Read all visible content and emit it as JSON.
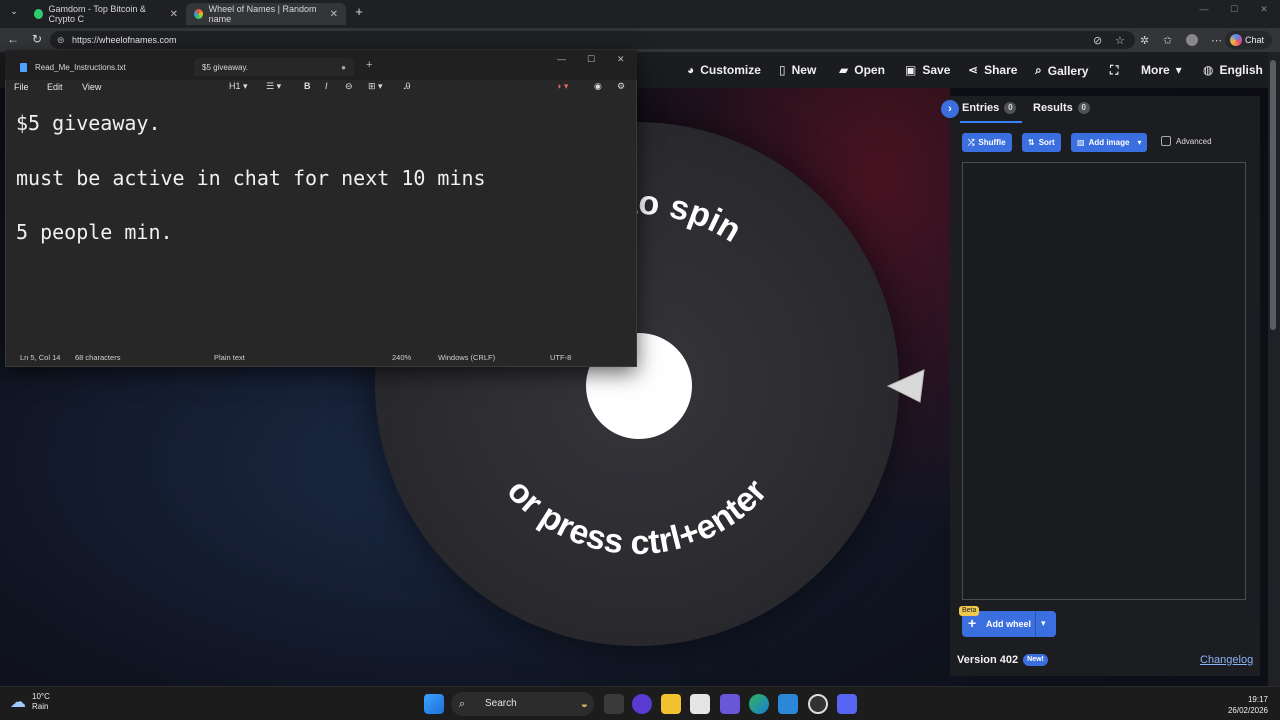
{
  "browser": {
    "tabs": [
      {
        "title": "Gamdom - Top Bitcoin & Crypto C",
        "favicon_color": "#2ecc71"
      },
      {
        "title": "Wheel of Names | Random name",
        "favicon_color": "#e74c3c"
      }
    ],
    "new_tab_symbol": "+",
    "url": "https://wheelofnames.com",
    "chat_label": "Chat"
  },
  "site_nav": {
    "customize": "Customize",
    "new": "New",
    "open": "Open",
    "save": "Save",
    "share": "Share",
    "gallery": "Gallery",
    "more": "More",
    "language": "English"
  },
  "wheel": {
    "text_top": "Click to spin",
    "visible_top_fragment": "to spin",
    "text_bottom": "or press ctrl+enter"
  },
  "sidebar": {
    "entries_label": "Entries",
    "entries_count": "0",
    "results_label": "Results",
    "results_count": "0",
    "shuffle": "Shuffle",
    "sort": "Sort",
    "add_image": "Add image",
    "advanced": "Advanced",
    "beta": "Beta",
    "add_wheel": "Add wheel",
    "version": "Version 402",
    "new_badge": "New!",
    "changelog": "Changelog"
  },
  "notepad": {
    "tabs": [
      "Read_Me_Instructions.txt",
      "$5 giveaway."
    ],
    "menu": [
      "File",
      "Edit",
      "View"
    ],
    "heading_dropdown": "H1",
    "lines": [
      "$5 giveaway.",
      "must be active in chat for next 10 mins",
      "5 people min."
    ],
    "status": {
      "position": "Ln 5, Col 14",
      "characters": "68 characters",
      "format": "Plain text",
      "zoom": "240%",
      "line_endings": "Windows (CRLF)",
      "encoding": "UTF-8"
    }
  },
  "taskbar": {
    "temperature": "10°C",
    "condition": "Rain",
    "search": "Search",
    "time": "19:17",
    "date": "26/02/2026"
  },
  "colors": {
    "accent": "#3b6fe0",
    "beta_badge": "#f2c94c",
    "link": "#8ab4f8"
  }
}
